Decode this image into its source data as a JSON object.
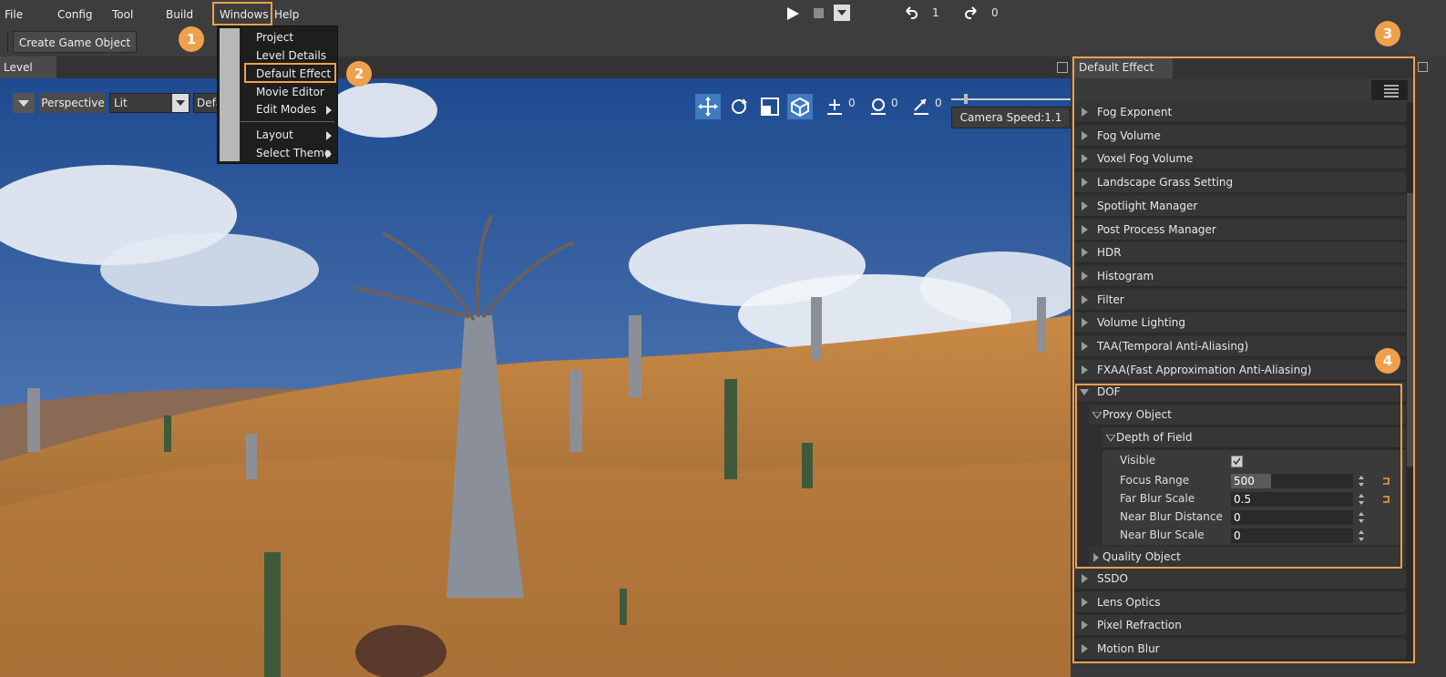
{
  "menu": {
    "file": "File",
    "config": "Config",
    "tool": "Tool",
    "build": "Build",
    "windows": "Windows",
    "help": "Help"
  },
  "playbar": {
    "undo_count": "1",
    "redo_count": "0"
  },
  "toolbar": {
    "create_game_object": "Create Game Object"
  },
  "level_tab": "Level",
  "viewport": {
    "perspective": "Perspective",
    "lit": "Lit",
    "default_short": "Defa",
    "move_count": "0",
    "rotate_count": "0",
    "scale_count": "0",
    "camera_speed": "Camera Speed:1.1"
  },
  "windows_menu": {
    "items": [
      "Project",
      "Level Details",
      "Default Effect",
      "Movie Editor",
      "Edit Modes",
      "Layout",
      "Select Theme"
    ]
  },
  "badges": [
    "1",
    "2",
    "3",
    "4"
  ],
  "panel": {
    "title": "Default Effect",
    "sections_top": [
      "Fog Exponent",
      "Fog Volume",
      "Voxel Fog Volume",
      "Landscape Grass Setting",
      "Spotlight Manager",
      "Post Process Manager",
      "HDR",
      "Histogram",
      "Filter",
      "Volume Lighting",
      "TAA(Temporal Anti-Aliasing)",
      "FXAA(Fast Approximation Anti-Aliasing)"
    ],
    "dof": {
      "label": "DOF",
      "proxy_object": "Proxy Object",
      "depth_of_field": "Depth of Field",
      "properties": [
        {
          "label": "Visible",
          "value": "",
          "type": "checkbox",
          "checked": true
        },
        {
          "label": "Focus Range",
          "value": "500",
          "fill_fraction": 0.33
        },
        {
          "label": "Far Blur Scale",
          "value": "0.5"
        },
        {
          "label": "Near Blur Distance",
          "value": "0"
        },
        {
          "label": "Near Blur Scale",
          "value": "0"
        }
      ],
      "quality_object": "Quality Object"
    },
    "sections_bottom": [
      "SSDO",
      "Lens Optics",
      "Pixel Refraction",
      "Motion Blur"
    ]
  },
  "colors": {
    "accent": "#f0a04b",
    "sky": "#2e5a9c",
    "sand": "#c0803f"
  }
}
